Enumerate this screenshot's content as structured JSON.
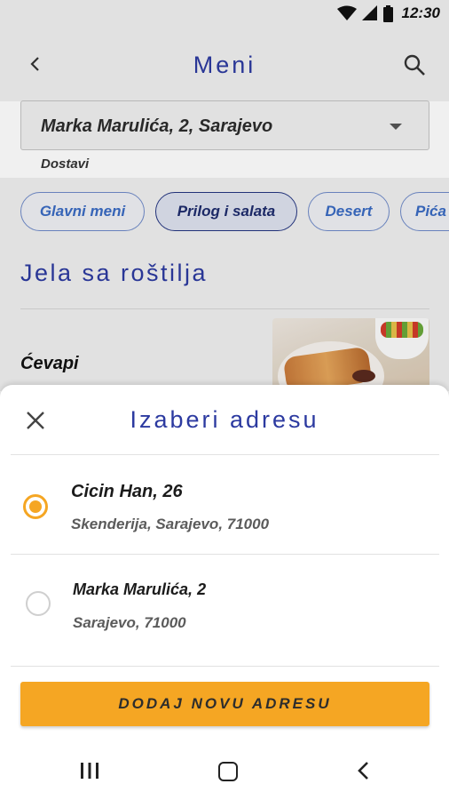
{
  "status_bar": {
    "time": "12:30"
  },
  "app_bar": {
    "title": "Meni"
  },
  "address_selector": {
    "value": "Marka Marulića, 2, Sarajevo",
    "mode_label": "Dostavi"
  },
  "categories": [
    {
      "label": "Glavni meni",
      "active": false
    },
    {
      "label": "Prilog i salata",
      "active": true
    },
    {
      "label": "Desert",
      "active": false
    },
    {
      "label": "Pića",
      "active": false
    }
  ],
  "menu_section": {
    "title": "Jela sa roštilja",
    "items": [
      {
        "name": "Ćevapi"
      }
    ]
  },
  "sheet": {
    "title": "Izaberi adresu",
    "addresses": [
      {
        "line1": "Cicin Han, 26",
        "line2": "Skenderija, Sarajevo, 71000",
        "selected": true
      },
      {
        "line1": "Marka Marulića, 2",
        "line2": "Sarajevo, 71000",
        "selected": false
      }
    ],
    "add_button_label": "DODAJ NOVU ADRESU"
  },
  "colors": {
    "accent": "#f5a623",
    "title_blue": "#2c3aa0",
    "chip_blue": "#3a6bc3"
  },
  "icons": {
    "status": [
      "wifi-icon",
      "signal-icon",
      "battery-icon"
    ],
    "app_bar": [
      "back-arrow-icon",
      "search-icon"
    ],
    "sheet": [
      "close-icon"
    ],
    "nav": [
      "recent-apps-icon",
      "home-icon",
      "nav-back-icon"
    ]
  }
}
